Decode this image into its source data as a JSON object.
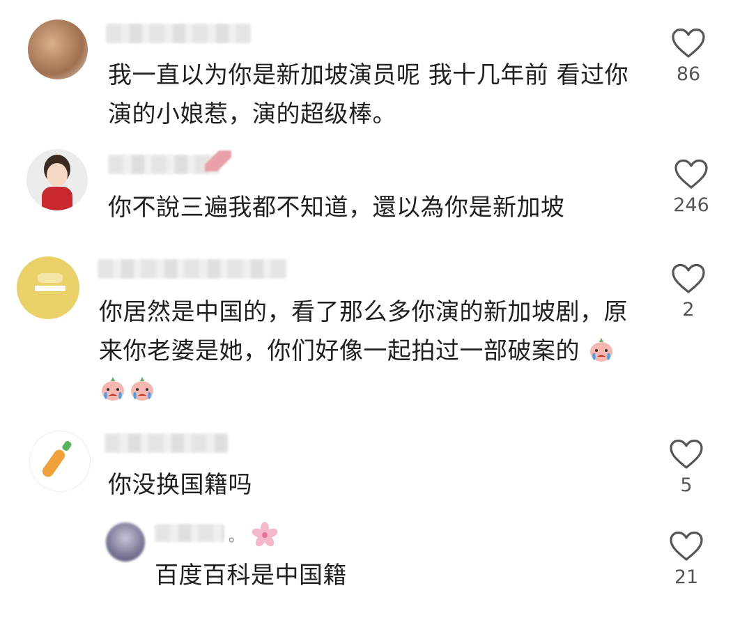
{
  "comments": [
    {
      "text": "我一直以为你是新加坡演员呢 我十几年前 看过你演的小娘惹，演的超级棒。",
      "likes": "86"
    },
    {
      "text": "你不說三遍我都不知道，還以為你是新加坡",
      "likes": "246"
    },
    {
      "text": "你居然是中国的，看了那么多你演的新加坡剧，原来你老婆是她，你们好像一起拍过一部破案的",
      "likes": "2",
      "emojis": [
        "crying-face-emoji",
        "crying-face-emoji",
        "crying-face-emoji"
      ]
    },
    {
      "text": "你没换国籍吗",
      "likes": "5"
    }
  ],
  "reply": {
    "text": "百度百科是中国籍",
    "likes": "21"
  },
  "colors": {
    "text": "#1f1f1f",
    "count": "#555555",
    "heart_stroke": "#555555"
  }
}
